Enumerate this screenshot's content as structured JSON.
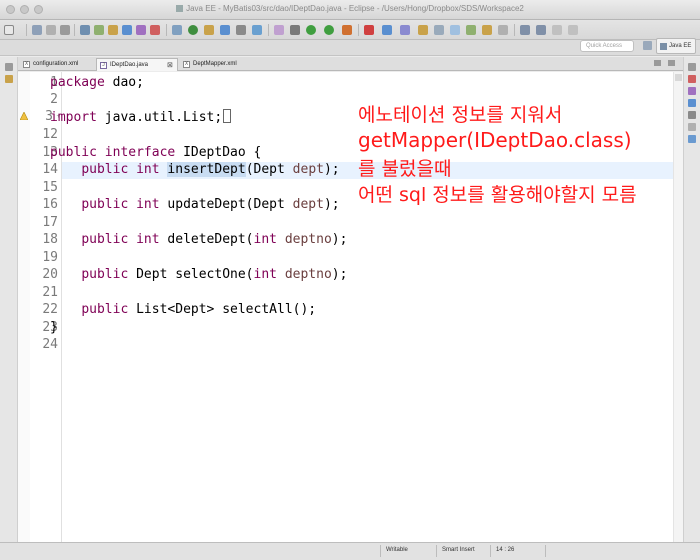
{
  "window": {
    "title": "Java EE - MyBatis03/src/dao/IDeptDao.java - Eclipse - /Users/Hong/Dropbox/SDS/Workspace2"
  },
  "toolbar": {
    "quick_access_placeholder": "Quick Access",
    "perspective_label": "Java EE"
  },
  "tabs": [
    {
      "label": "configuration.xml",
      "active": false
    },
    {
      "label": "IDeptDao.java",
      "active": true,
      "close": "⊠"
    },
    {
      "label": "DeptMapper.xml",
      "active": false
    }
  ],
  "editor": {
    "lines": [
      {
        "num": "1",
        "text": "package dao;"
      },
      {
        "num": "2",
        "text": ""
      },
      {
        "num": "3",
        "text": "import java.util.List;"
      },
      {
        "num": "12",
        "text": ""
      },
      {
        "num": "13",
        "text": "public interface IDeptDao {"
      },
      {
        "num": "14",
        "text": "    public int insertDept(Dept dept);"
      },
      {
        "num": "15",
        "text": ""
      },
      {
        "num": "16",
        "text": "    public int updateDept(Dept dept);"
      },
      {
        "num": "17",
        "text": ""
      },
      {
        "num": "18",
        "text": "    public int deleteDept(int deptno);"
      },
      {
        "num": "19",
        "text": ""
      },
      {
        "num": "20",
        "text": "    public Dept selectOne(int deptno);"
      },
      {
        "num": "21",
        "text": ""
      },
      {
        "num": "22",
        "text": "    public List<Dept> selectAll();"
      },
      {
        "num": "23",
        "text": "}"
      },
      {
        "num": "24",
        "text": ""
      }
    ],
    "fold_marker_line3": "+"
  },
  "annotation": {
    "line1": "에노테이션 정보를 지워서",
    "line2": "getMapper(IDeptDao.class)",
    "line3": "를 불렀을때",
    "line4": "어떤 sql 정보를 활용해야할지 모름"
  },
  "statusbar": {
    "writable": "Writable",
    "insert_mode": "Smart Insert",
    "position": "14 : 26"
  }
}
